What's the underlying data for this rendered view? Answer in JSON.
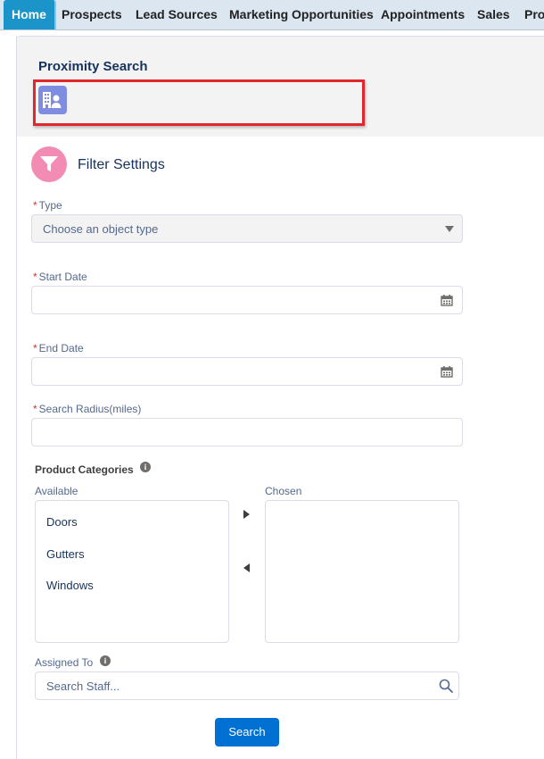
{
  "nav": {
    "tabs": [
      {
        "label": "Home",
        "active": true
      },
      {
        "label": "Prospects"
      },
      {
        "label": "Lead Sources"
      },
      {
        "label": "Marketing Opportunities"
      },
      {
        "label": "Appointments"
      },
      {
        "label": "Sales"
      },
      {
        "label": "Pro"
      }
    ]
  },
  "card": {
    "title": "Proximity Search",
    "icon": "building-person-icon"
  },
  "filter": {
    "title": "Filter Settings",
    "icon": "funnel-icon"
  },
  "form": {
    "required_marker": "*",
    "type": {
      "label": "Type",
      "placeholder": "Choose an object type"
    },
    "start_date": {
      "label": "Start Date",
      "value": ""
    },
    "end_date": {
      "label": "End Date",
      "value": ""
    },
    "radius": {
      "label": "Search Radius(miles)",
      "value": ""
    },
    "product_categories": {
      "label": "Product Categories",
      "available_label": "Available",
      "chosen_label": "Chosen",
      "available": [
        "Doors",
        "Gutters",
        "Windows"
      ],
      "chosen": []
    },
    "assigned_to": {
      "label": "Assigned To",
      "placeholder": "Search Staff..."
    },
    "search_button": "Search"
  },
  "colors": {
    "tab_active": "#1b95c9",
    "highlight_border": "#e1262d",
    "button": "#0070d2",
    "required": "#c23934"
  }
}
